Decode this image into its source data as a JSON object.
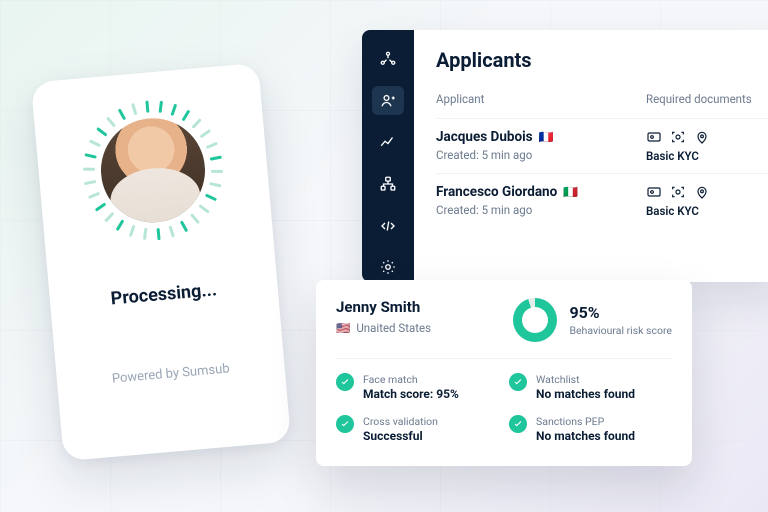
{
  "phone": {
    "status_text": "Processing...",
    "footer_text": "Powered by Sumsub"
  },
  "dashboard": {
    "title": "Applicants",
    "columns": {
      "applicant": "Applicant",
      "documents": "Required documents"
    },
    "rows": [
      {
        "name": "Jacques Dubois",
        "flag": "🇫🇷",
        "created": "Created: 5 min ago",
        "doc_label": "Basic KYC"
      },
      {
        "name": "Francesco Giordano",
        "flag": "🇮🇹",
        "created": "Created: 5 min ago",
        "doc_label": "Basic KYC"
      }
    ],
    "sidebar_icons": [
      "hub-icon",
      "person-icon",
      "trend-icon",
      "tree-icon",
      "code-icon",
      "gear-icon"
    ]
  },
  "score_card": {
    "name": "Jenny Smith",
    "country_flag": "🇺🇸",
    "country": "Unaited States",
    "percent": "95%",
    "percent_label": "Behavioural risk score",
    "checks": [
      {
        "label": "Face match",
        "value": "Match score: 95%"
      },
      {
        "label": "Watchlist",
        "value": "No matches found"
      },
      {
        "label": "Cross validation",
        "value": "Successful"
      },
      {
        "label": "Sanctions PEP",
        "value": "No matches found"
      }
    ]
  },
  "colors": {
    "accent": "#1fc59b",
    "navy": "#0a1d35"
  }
}
